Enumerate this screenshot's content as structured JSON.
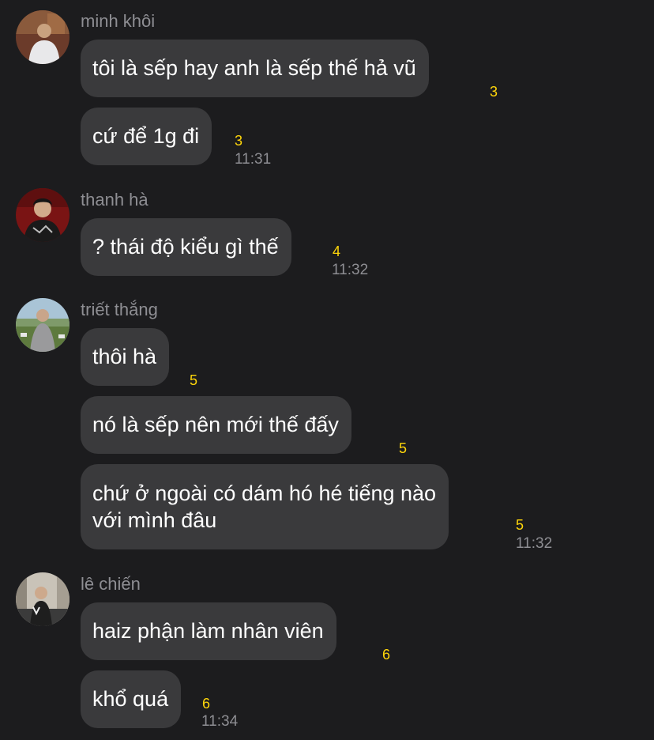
{
  "colors": {
    "background": "#1c1c1e",
    "bubble": "#3a3a3c",
    "bubble_text": "#ffffff",
    "sender_name": "#8e8e93",
    "timestamp": "#8e8e93",
    "reaction_count": "#ffd60a"
  },
  "groups": [
    {
      "sender": "minh khôi",
      "avatar": "avatar-photo-icon",
      "messages": [
        {
          "text": "tôi là sếp hay anh là sếp thế hả vũ",
          "count": "3"
        },
        {
          "text": "cứ để 1g đi",
          "count": "3"
        }
      ],
      "time": "11:31"
    },
    {
      "sender": "thanh hà",
      "avatar": "avatar-photo-icon",
      "messages": [
        {
          "text": "? thái độ kiểu gì thế",
          "count": "4"
        }
      ],
      "time": "11:32"
    },
    {
      "sender": "triết thắng",
      "avatar": "avatar-photo-icon",
      "messages": [
        {
          "text": "thôi hà",
          "count": "5"
        },
        {
          "text": "nó là sếp nên mới thế đấy",
          "count": "5"
        },
        {
          "text_line1": "chứ ở ngoài có dám hó hé tiếng nào",
          "text_line2": "với mình đâu",
          "count": "5"
        }
      ],
      "time": "11:32"
    },
    {
      "sender": "lê chiến",
      "avatar": "avatar-photo-icon",
      "messages": [
        {
          "text": "haiz phận làm nhân viên",
          "count": "6"
        },
        {
          "text": "khổ quá",
          "count": "6"
        }
      ],
      "time": "11:34"
    }
  ]
}
